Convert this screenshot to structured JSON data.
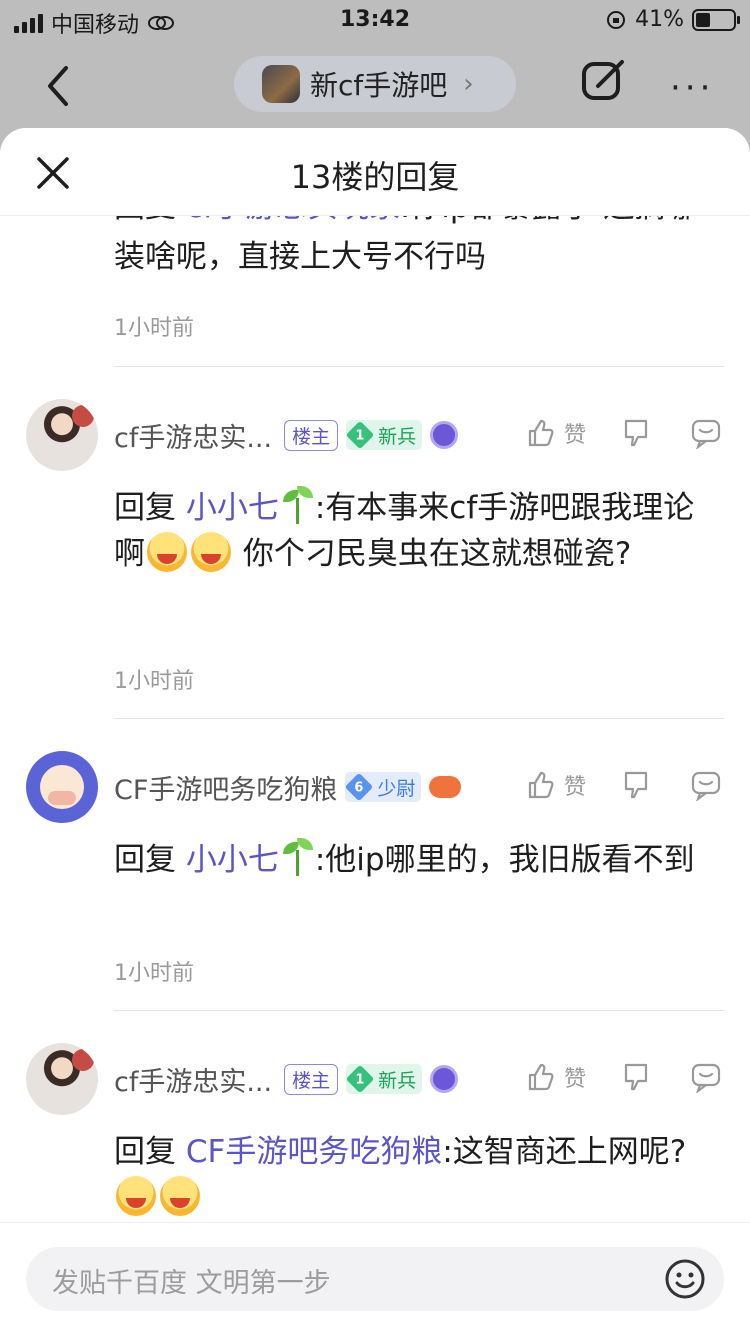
{
  "status": {
    "carrier": "中国移动",
    "time": "13:42",
    "battery": "41%"
  },
  "nav": {
    "forum_name": "新cf手游吧",
    "chevron": "›",
    "more": "···"
  },
  "sheet": {
    "title": "13楼的回复"
  },
  "partial": {
    "prefix": "回复 ",
    "mention": "cf手游忠实玩家",
    "text": ":你ip都暴露了 还搁哪装啥呢，直接上大号不行吗",
    "time": "1小时前"
  },
  "comments": [
    {
      "username": "cf手游忠实...",
      "owner_badge": "楼主",
      "level_num": "1",
      "level_name": "新兵",
      "like_label": "赞",
      "reply_prefix": "回复 ",
      "mention": "小小七",
      "text_a": ":有本事来cf手游吧跟我理论啊",
      "text_b": " 你个刁民臭虫在这就想碰瓷?",
      "time": "1小时前"
    },
    {
      "username": "CF手游吧务吃狗粮",
      "level_num": "6",
      "level_name": "少尉",
      "like_label": "赞",
      "reply_prefix": "回复 ",
      "mention": "小小七",
      "text": ":他ip哪里的，我旧版看不到",
      "time": "1小时前"
    },
    {
      "username": "cf手游忠实...",
      "owner_badge": "楼主",
      "level_num": "1",
      "level_name": "新兵",
      "like_label": "赞",
      "reply_prefix": "回复 ",
      "mention": "CF手游吧务吃狗粮",
      "text": ":这智商还上网呢?"
    }
  ],
  "input": {
    "placeholder": "发贴千百度 文明第一步"
  },
  "colors": {
    "accent": "#5b55c8",
    "meta_gray": "#9a9a9a",
    "green_level": "#19a45a",
    "blue_level": "#3f7be0"
  },
  "icons": [
    "signal-icon",
    "hd-icon",
    "orientation-lock-icon",
    "battery-icon",
    "back-icon",
    "edit-icon",
    "more-icon",
    "close-icon",
    "like-icon",
    "dislike-icon",
    "reply-icon",
    "smile-icon"
  ]
}
